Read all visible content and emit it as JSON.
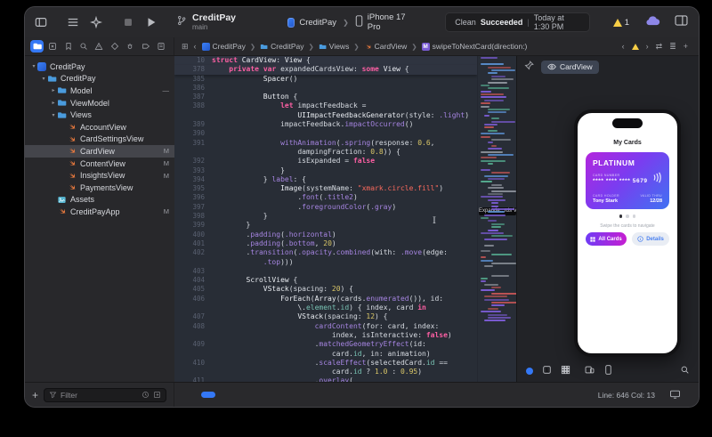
{
  "toolbar": {
    "project": "CreditPay",
    "branch": "main",
    "scheme": "CreditPay",
    "device": "iPhone 17 Pro",
    "status_left": "Clean",
    "status_bold": "Succeeded",
    "status_sep": "|",
    "status_right": "Today at 1:30 PM",
    "warning_count": "1",
    "left_icons": [
      "sidebar-toggle-icon",
      "list-icon",
      "compose-sparkle-icon",
      "stop-icon",
      "run-icon"
    ]
  },
  "navigator_icons": [
    "project",
    "errors",
    "bookmarks",
    "find",
    "issues",
    "tests",
    "debug",
    "breakpoints",
    "reports"
  ],
  "jumpbar": {
    "grid_glyph": "⊞",
    "back_glyph": "‹",
    "crumbs": [
      {
        "icon": "app",
        "label": "CreditPay"
      },
      {
        "icon": "folder",
        "label": "CreditPay"
      },
      {
        "icon": "folder",
        "label": "Views"
      },
      {
        "icon": "swift",
        "label": "CardView"
      },
      {
        "icon": "m",
        "label": "swipeToNextCard(direction:)"
      }
    ],
    "right_glyphs": {
      "prev": "‹",
      "next": "›",
      "swap": "⇄",
      "lines": "≣",
      "add": "+"
    }
  },
  "sidebar": {
    "tree": [
      {
        "depth": 0,
        "disc": "▾",
        "icon": "project",
        "label": "CreditPay"
      },
      {
        "depth": 1,
        "disc": "▾",
        "icon": "folder",
        "label": "CreditPay"
      },
      {
        "depth": 2,
        "disc": "▸",
        "icon": "folder",
        "label": "Model",
        "badge": "—"
      },
      {
        "depth": 2,
        "disc": "▸",
        "icon": "folder",
        "label": "ViewModel"
      },
      {
        "depth": 2,
        "disc": "▾",
        "icon": "folder",
        "label": "Views"
      },
      {
        "depth": 3,
        "disc": "",
        "icon": "swift",
        "label": "AccountView"
      },
      {
        "depth": 3,
        "disc": "",
        "icon": "swift",
        "label": "CardSettingsView"
      },
      {
        "depth": 3,
        "disc": "",
        "icon": "swift",
        "label": "CardView",
        "badge": "M",
        "selected": true
      },
      {
        "depth": 3,
        "disc": "",
        "icon": "swift",
        "label": "ContentView",
        "badge": "M"
      },
      {
        "depth": 3,
        "disc": "",
        "icon": "swift",
        "label": "InsightsView",
        "badge": "M"
      },
      {
        "depth": 3,
        "disc": "",
        "icon": "swift",
        "label": "PaymentsView"
      },
      {
        "depth": 2,
        "disc": "",
        "icon": "assets",
        "label": "Assets"
      },
      {
        "depth": 2,
        "disc": "",
        "icon": "swift",
        "label": "CreditPayApp",
        "badge": "M"
      }
    ],
    "add_label": "+",
    "filter_placeholder": "Filter"
  },
  "editor": {
    "lines": [
      {
        "n": "10",
        "sticky": true,
        "t": [
          [
            "k",
            "struct "
          ],
          [
            "ty",
            "CardView"
          ],
          [
            "p",
            ": "
          ],
          [
            "ty",
            "View"
          ],
          [
            "p",
            " {"
          ]
        ]
      },
      {
        "n": "378",
        "sticky": true,
        "t": [
          [
            "p",
            "    "
          ],
          [
            "k",
            "private"
          ],
          [
            "p",
            " "
          ],
          [
            "k",
            "var"
          ],
          [
            "p",
            " expandedCardsView: "
          ],
          [
            "k",
            "some"
          ],
          [
            "p",
            " "
          ],
          [
            "ty",
            "View"
          ],
          [
            "p",
            " {"
          ]
        ]
      },
      {
        "n": "385",
        "t": [
          [
            "p",
            "            "
          ],
          [
            "ty",
            "Spacer"
          ],
          [
            "p",
            "()"
          ]
        ]
      },
      {
        "n": "386",
        "t": []
      },
      {
        "n": "387",
        "t": [
          [
            "p",
            "            "
          ],
          [
            "ty",
            "Button"
          ],
          [
            "p",
            " {"
          ]
        ]
      },
      {
        "n": "388",
        "t": [
          [
            "p",
            "                "
          ],
          [
            "k",
            "let"
          ],
          [
            "p",
            " impactFeedback ="
          ]
        ]
      },
      {
        "n": "",
        "t": [
          [
            "p",
            "                    "
          ],
          [
            "ty",
            "UIImpactFeedbackGenerator"
          ],
          [
            "p",
            "(style: "
          ],
          [
            "fn",
            ".light"
          ],
          [
            "p",
            ")"
          ]
        ]
      },
      {
        "n": "389",
        "t": [
          [
            "p",
            "                impactFeedback."
          ],
          [
            "fn",
            "impactOccurred"
          ],
          [
            "p",
            "()"
          ]
        ]
      },
      {
        "n": "390",
        "t": []
      },
      {
        "n": "391",
        "t": [
          [
            "p",
            "                "
          ],
          [
            "fn",
            "withAnimation"
          ],
          [
            "p",
            "("
          ],
          [
            "fn",
            ".spring"
          ],
          [
            "p",
            "(response: "
          ],
          [
            "n",
            "0.6"
          ],
          [
            "p",
            ","
          ]
        ]
      },
      {
        "n": "",
        "t": [
          [
            "p",
            "                    dampingFraction: "
          ],
          [
            "n",
            "0.8"
          ],
          [
            "p",
            ")) {"
          ]
        ]
      },
      {
        "n": "392",
        "t": [
          [
            "p",
            "                    isExpanded = "
          ],
          [
            "k",
            "false"
          ]
        ]
      },
      {
        "n": "393",
        "t": [
          [
            "p",
            "                }"
          ]
        ]
      },
      {
        "n": "394",
        "t": [
          [
            "p",
            "            } "
          ],
          [
            "fn",
            "label"
          ],
          [
            "p",
            ": {"
          ]
        ]
      },
      {
        "n": "395",
        "t": [
          [
            "p",
            "                "
          ],
          [
            "ty",
            "Image"
          ],
          [
            "p",
            "(systemName: "
          ],
          [
            "s",
            "\"xmark.circle.fill\""
          ],
          [
            "p",
            ")"
          ]
        ]
      },
      {
        "n": "396",
        "t": [
          [
            "p",
            "                    ."
          ],
          [
            "fn",
            "font"
          ],
          [
            "p",
            "("
          ],
          [
            "fn",
            ".title2"
          ],
          [
            "p",
            ")"
          ]
        ]
      },
      {
        "n": "397",
        "t": [
          [
            "p",
            "                    ."
          ],
          [
            "fn",
            "foregroundColor"
          ],
          [
            "p",
            "("
          ],
          [
            "fn",
            ".gray"
          ],
          [
            "p",
            ")"
          ]
        ]
      },
      {
        "n": "398",
        "t": [
          [
            "p",
            "            }"
          ]
        ]
      },
      {
        "n": "399",
        "t": [
          [
            "p",
            "        }"
          ]
        ]
      },
      {
        "n": "400",
        "t": [
          [
            "p",
            "        ."
          ],
          [
            "fn",
            "padding"
          ],
          [
            "p",
            "("
          ],
          [
            "fn",
            ".horizontal"
          ],
          [
            "p",
            ")"
          ]
        ]
      },
      {
        "n": "401",
        "t": [
          [
            "p",
            "        ."
          ],
          [
            "fn",
            "padding"
          ],
          [
            "p",
            "("
          ],
          [
            "fn",
            ".bottom"
          ],
          [
            "p",
            ", "
          ],
          [
            "n",
            "20"
          ],
          [
            "p",
            ")"
          ]
        ]
      },
      {
        "n": "402",
        "t": [
          [
            "p",
            "        ."
          ],
          [
            "fn",
            "transition"
          ],
          [
            "p",
            "("
          ],
          [
            "fn",
            ".opacity"
          ],
          [
            "p",
            "."
          ],
          [
            "fn",
            "combined"
          ],
          [
            "p",
            "(with: "
          ],
          [
            "fn",
            ".move"
          ],
          [
            "p",
            "(edge:"
          ]
        ]
      },
      {
        "n": "",
        "t": [
          [
            "p",
            "            "
          ],
          [
            "fn",
            ".top"
          ],
          [
            "p",
            ")))"
          ]
        ]
      },
      {
        "n": "403",
        "t": []
      },
      {
        "n": "404",
        "t": [
          [
            "p",
            "        "
          ],
          [
            "ty",
            "ScrollView"
          ],
          [
            "p",
            " {"
          ]
        ]
      },
      {
        "n": "405",
        "t": [
          [
            "p",
            "            "
          ],
          [
            "ty",
            "VStack"
          ],
          [
            "p",
            "(spacing: "
          ],
          [
            "n",
            "20"
          ],
          [
            "p",
            ") {"
          ]
        ]
      },
      {
        "n": "406",
        "t": [
          [
            "p",
            "                "
          ],
          [
            "ty",
            "ForEach"
          ],
          [
            "p",
            "("
          ],
          [
            "ty",
            "Array"
          ],
          [
            "p",
            "(cards."
          ],
          [
            "fn",
            "enumerated"
          ],
          [
            "p",
            "()), id:"
          ]
        ]
      },
      {
        "n": "",
        "t": [
          [
            "p",
            "                    \\."
          ],
          [
            "pr",
            "element"
          ],
          [
            "p",
            "."
          ],
          [
            "pr",
            "id"
          ],
          [
            "p",
            ") { index, card "
          ],
          [
            "k",
            "in"
          ]
        ]
      },
      {
        "n": "407",
        "t": [
          [
            "p",
            "                    "
          ],
          [
            "ty",
            "VStack"
          ],
          [
            "p",
            "(spacing: "
          ],
          [
            "n",
            "12"
          ],
          [
            "p",
            ") {"
          ]
        ]
      },
      {
        "n": "408",
        "t": [
          [
            "p",
            "                        "
          ],
          [
            "fn",
            "cardContent"
          ],
          [
            "p",
            "(for: card, index:"
          ]
        ]
      },
      {
        "n": "",
        "t": [
          [
            "p",
            "                            index, isInteractive: "
          ],
          [
            "k",
            "false"
          ],
          [
            "p",
            ")"
          ]
        ]
      },
      {
        "n": "409",
        "t": [
          [
            "p",
            "                        ."
          ],
          [
            "fn",
            "matchedGeometryEffect"
          ],
          [
            "p",
            "(id:"
          ]
        ]
      },
      {
        "n": "",
        "t": [
          [
            "p",
            "                            card."
          ],
          [
            "pr",
            "id"
          ],
          [
            "p",
            ", in: animation)"
          ]
        ]
      },
      {
        "n": "410",
        "t": [
          [
            "p",
            "                        ."
          ],
          [
            "fn",
            "scaleEffect"
          ],
          [
            "p",
            "("
          ],
          [
            "p",
            "selectedCard."
          ],
          [
            "pr",
            "id"
          ],
          [
            "p",
            " =="
          ]
        ]
      },
      {
        "n": "",
        "t": [
          [
            "p",
            "                            card."
          ],
          [
            "pr",
            "id"
          ],
          [
            "p",
            " ? "
          ],
          [
            "n",
            "1.0"
          ],
          [
            "p",
            " : "
          ],
          [
            "n",
            "0.95"
          ],
          [
            "p",
            ")"
          ]
        ]
      },
      {
        "n": "411",
        "t": [
          [
            "p",
            "                        ."
          ],
          [
            "fn",
            "overlay"
          ],
          [
            "p",
            "("
          ]
        ]
      }
    ]
  },
  "minimap": {
    "tooltip": "Expande...rds View"
  },
  "preview": {
    "tab_label": "CardView",
    "phone": {
      "title": "My Cards",
      "card": {
        "tier": "PLATINUM",
        "number_label": "CARD NUMBER",
        "number": "**** **** **** 5679",
        "holder_label": "CARD HOLDER",
        "holder": "Tony Stark",
        "valid_label": "VALID THRU",
        "valid": "12/28"
      },
      "hint": "Swipe the cards to navigate",
      "buttons": {
        "all_cards": "All Cards",
        "details": "Details"
      }
    }
  },
  "statusbar": {
    "line_col": "Line: 646  Col: 13"
  },
  "colors": {
    "accent": "#3478f6",
    "warning": "#f7ce46",
    "card_gradient_start": "#b326dd",
    "card_gradient_end": "#3f72f2"
  }
}
